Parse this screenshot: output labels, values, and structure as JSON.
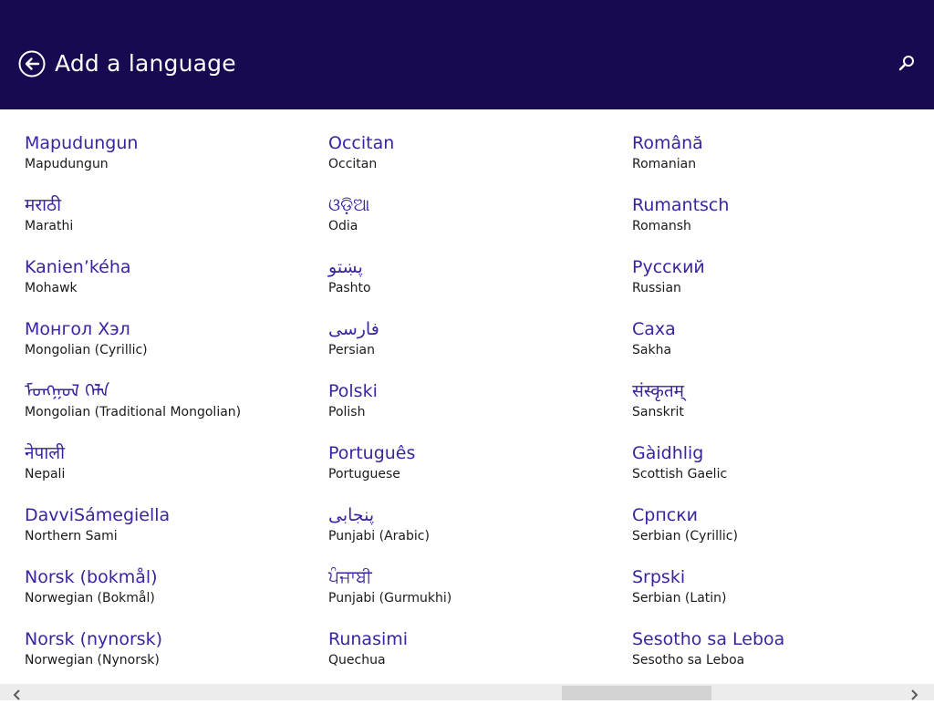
{
  "header": {
    "title": "Add a language",
    "back_icon": "back-arrow-circle-icon",
    "search_icon": "search-icon",
    "background_color": "#180a50"
  },
  "languages": {
    "accent_color": "#3a24a2",
    "columns": [
      [
        {
          "native": "Mapudungun",
          "english": "Mapudungun"
        },
        {
          "native": "मराठी",
          "english": "Marathi"
        },
        {
          "native": "Kanien’kéha",
          "english": "Mohawk"
        },
        {
          "native": "Монгол Хэл",
          "english": "Mongolian (Cyrillic)"
        },
        {
          "native": "ᠮᠣᠩᠭᠣᠯ ᠬᠡᠯᠡ",
          "english": "Mongolian (Traditional Mongolian)"
        },
        {
          "native": "नेपाली",
          "english": "Nepali"
        },
        {
          "native": "DavviSámegiella",
          "english": "Northern Sami"
        },
        {
          "native": "Norsk (bokmål)",
          "english": "Norwegian (Bokmål)"
        },
        {
          "native": "Norsk (nynorsk)",
          "english": "Norwegian (Nynorsk)"
        }
      ],
      [
        {
          "native": "Occitan",
          "english": "Occitan"
        },
        {
          "native": "ଓଡ଼ିଆ",
          "english": "Odia"
        },
        {
          "native": "پښتو",
          "english": "Pashto"
        },
        {
          "native": "فارسی",
          "english": "Persian"
        },
        {
          "native": "Polski",
          "english": "Polish"
        },
        {
          "native": "Português",
          "english": "Portuguese"
        },
        {
          "native": "پنجابی",
          "english": "Punjabi (Arabic)"
        },
        {
          "native": "ਪੰਜਾਬੀ",
          "english": "Punjabi (Gurmukhi)"
        },
        {
          "native": "Runasimi",
          "english": "Quechua"
        }
      ],
      [
        {
          "native": "Română",
          "english": "Romanian"
        },
        {
          "native": "Rumantsch",
          "english": "Romansh"
        },
        {
          "native": "Русский",
          "english": "Russian"
        },
        {
          "native": "Саха",
          "english": "Sakha"
        },
        {
          "native": "संस्कृतम्",
          "english": "Sanskrit"
        },
        {
          "native": "Gàidhlig",
          "english": "Scottish Gaelic"
        },
        {
          "native": "Српски",
          "english": "Serbian (Cyrillic)"
        },
        {
          "native": "Srpski",
          "english": "Serbian (Latin)"
        },
        {
          "native": "Sesotho sa Leboa",
          "english": "Sesotho sa Leboa"
        }
      ]
    ]
  },
  "scrollbar": {
    "left_icon": "chevron-left-icon",
    "right_icon": "chevron-right-icon",
    "position_fraction": 0.6
  }
}
